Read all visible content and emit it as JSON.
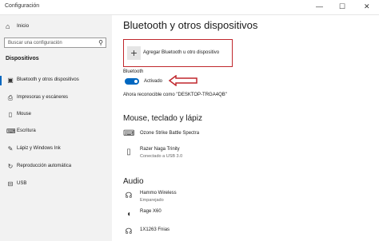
{
  "window": {
    "title": "Configuración",
    "minimize": "—",
    "maximize": "☐",
    "close": "✕"
  },
  "sidebar": {
    "home": "Inicio",
    "search_placeholder": "Buscar una configuración",
    "section": "Dispositivos",
    "items": [
      {
        "label": "Bluetooth y otros dispositivos",
        "icon": "bluetooth-devices-icon"
      },
      {
        "label": "Impresoras y escáneres",
        "icon": "printer-icon"
      },
      {
        "label": "Mouse",
        "icon": "mouse-icon"
      },
      {
        "label": "Escritura",
        "icon": "keyboard-icon"
      },
      {
        "label": "Lápiz y Windows Ink",
        "icon": "pen-icon"
      },
      {
        "label": "Reproducción automática",
        "icon": "autoplay-icon"
      },
      {
        "label": "USB",
        "icon": "usb-icon"
      }
    ]
  },
  "main": {
    "title": "Bluetooth y otros dispositivos",
    "add_button": "Agregar Bluetooth u otro dispositivo",
    "bluetooth_label": "Bluetooth",
    "toggle_state": "Activado",
    "discoverable": "Ahora reconocible como \"DESKTOP-TRGA4QB\"",
    "section_input": "Mouse, teclado y lápiz",
    "input_devices": [
      {
        "name": "Ozone Strike Battle Spectra",
        "status": "",
        "icon": "keyboard-icon"
      },
      {
        "name": "Razer Naga Trinity",
        "status": "Conectado a USB 3.0",
        "icon": "mouse-icon"
      }
    ],
    "section_audio": "Audio",
    "audio_devices": [
      {
        "name": "Hammo Wireless",
        "status": "Emparejado",
        "icon": "headset-icon"
      },
      {
        "name": "Rage X60",
        "status": "",
        "icon": "speaker-icon"
      },
      {
        "name": "1X1263 Fnias",
        "status": "",
        "icon": "headset-icon"
      }
    ]
  },
  "colors": {
    "accent": "#0067c0",
    "highlight": "#c0272d",
    "sidebar_bg": "#f2f2f2"
  }
}
